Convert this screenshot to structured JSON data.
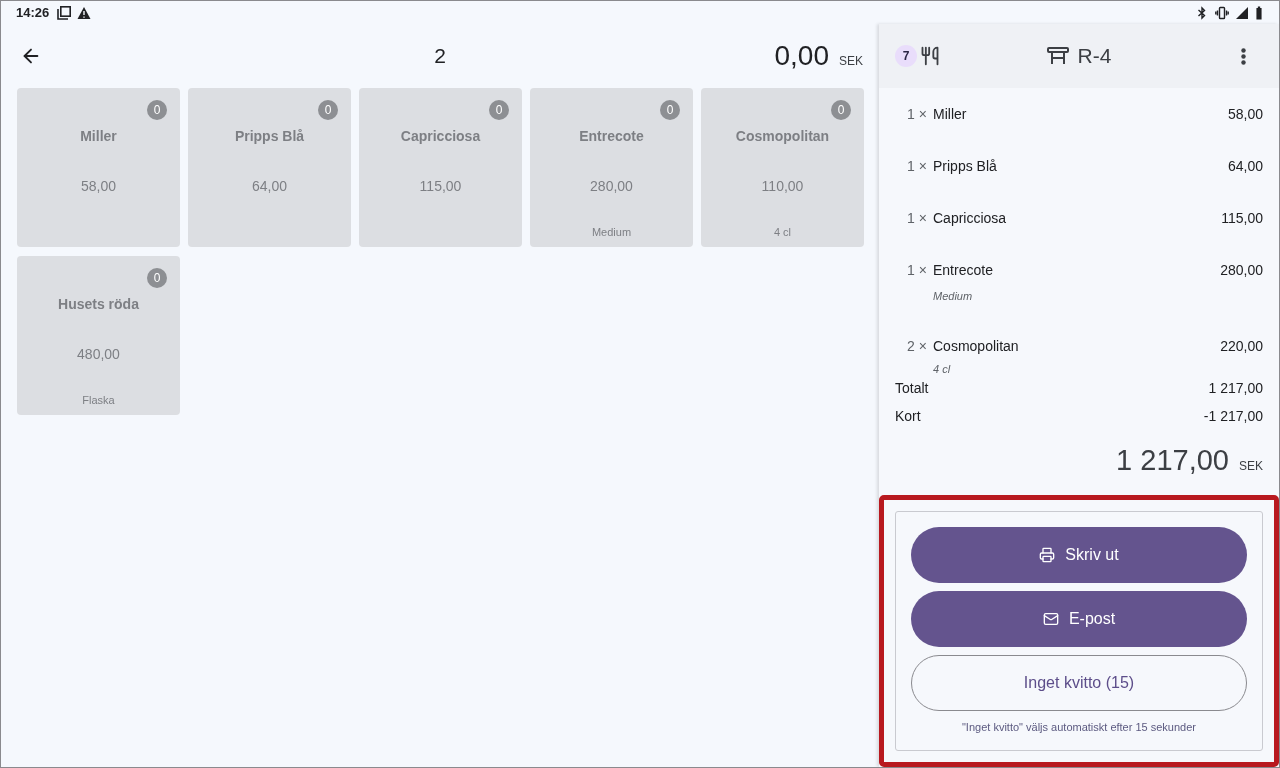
{
  "status_bar": {
    "time": "14:26"
  },
  "toolbar": {
    "title": "2",
    "amount": "0,00",
    "currency": "SEK"
  },
  "products": [
    {
      "name": "Miller",
      "price": "58,00",
      "count": "0",
      "disabled": true
    },
    {
      "name": "Pripps Blå",
      "price": "64,00",
      "count": "0",
      "disabled": true
    },
    {
      "name": "Capricciosa",
      "price": "115,00",
      "count": "0",
      "disabled": true
    },
    {
      "name": "Entrecote",
      "price": "280,00",
      "note": "Medium",
      "count": "0",
      "disabled": true
    },
    {
      "name": "Cosmopolitan",
      "price": "110,00",
      "note": "4 cl",
      "count": "0",
      "disabled": true
    },
    {
      "name": "Husets röda",
      "price": "480,00",
      "note": "Flaska",
      "count": "0",
      "disabled": true
    }
  ],
  "order_panel": {
    "header": {
      "covers": "7",
      "table": "R-4"
    },
    "lines": [
      {
        "quantity": "1 ×",
        "name": "Miller",
        "price": "58,00"
      },
      {
        "quantity": "1 ×",
        "name": "Pripps Blå",
        "price": "64,00"
      },
      {
        "quantity": "1 ×",
        "name": "Capricciosa",
        "price": "115,00"
      },
      {
        "quantity": "1 ×",
        "name": "Entrecote",
        "price": "280,00",
        "note": "Medium"
      },
      {
        "quantity": "2 ×",
        "name": "Cosmopolitan",
        "price": "220,00",
        "note": "4 cl"
      }
    ],
    "totals": [
      {
        "label": "Totalt",
        "amount": "1 217,00"
      },
      {
        "label": "Kort",
        "amount": "-1 217,00"
      }
    ],
    "grand_total": {
      "amount": "1 217,00",
      "currency": "SEK"
    }
  },
  "receipt_options": {
    "highlighted": true,
    "buttons": [
      {
        "kind": "print",
        "label": "Skriv ut"
      },
      {
        "kind": "email",
        "label": "E-post"
      },
      {
        "kind": "skip",
        "label": "Inget kvitto (15)"
      }
    ],
    "caption": "\"Inget kvitto\" väljs automatiskt efter 15 sekunder"
  }
}
